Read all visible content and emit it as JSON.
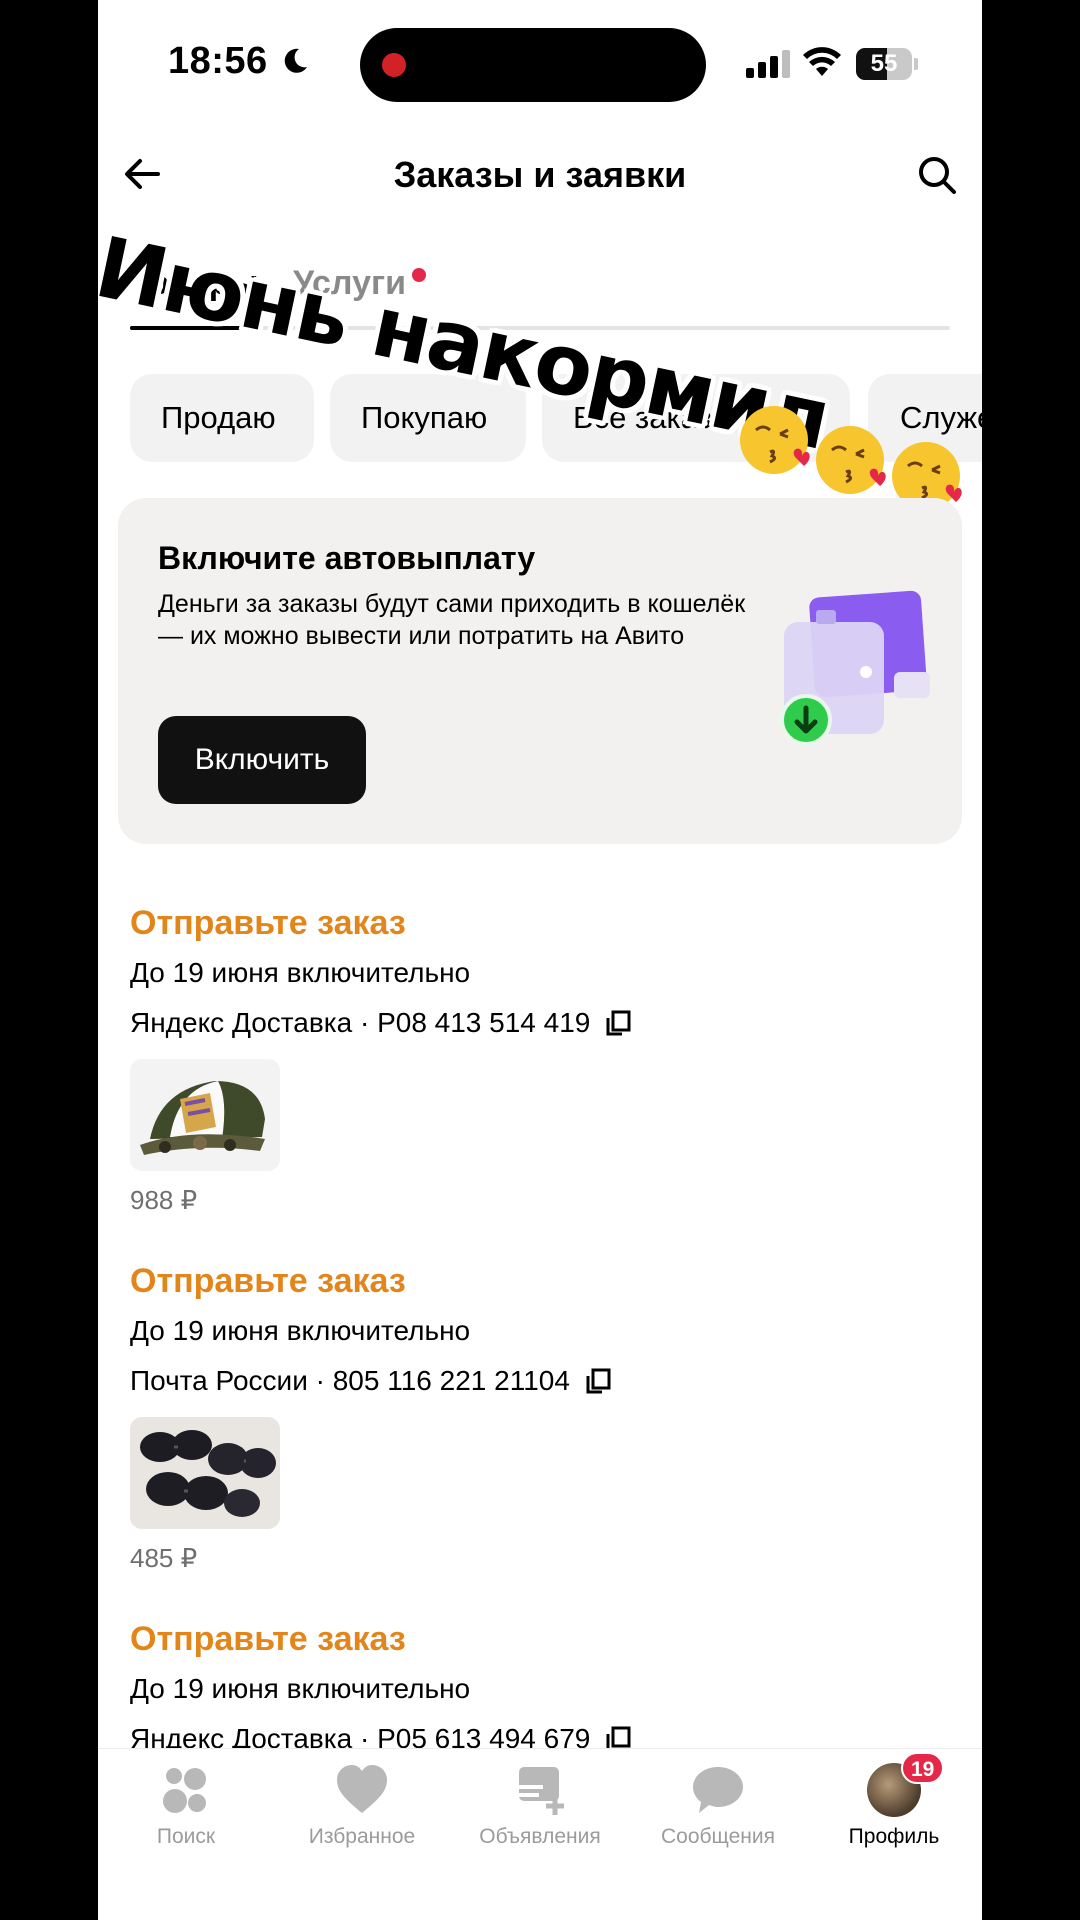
{
  "status_bar": {
    "time": "18:56",
    "battery": "55",
    "battery_level": 0.55
  },
  "header": {
    "title": "Заказы и заявки"
  },
  "tabs": [
    {
      "label": "Товары",
      "active": true
    },
    {
      "label": "Услуги",
      "active": false,
      "has_dot": true
    }
  ],
  "filters": [
    {
      "label": "Продаю"
    },
    {
      "label": "Покупаю"
    },
    {
      "label": "Все заказы",
      "dropdown": true
    },
    {
      "label": "Служебные"
    }
  ],
  "overlay": {
    "text": "Июнь накормил",
    "emoji": "kissing-face-with-heart"
  },
  "promo": {
    "title": "Включите автовыплату",
    "text": "Деньги за заказы будут сами приходить в кошелёк — их можно вывести или потратить на Авито",
    "button": "Включить"
  },
  "orders": [
    {
      "status": "Отправьте заказ",
      "deadline": "До 19 июня включительно",
      "tracking": "Яндекс Доставка · P08 413 514 419",
      "image": "camo-trucker-cap",
      "price": "988 ₽"
    },
    {
      "status": "Отправьте заказ",
      "deadline": "До 19 июня включительно",
      "tracking": "Почта России · 805 116 221 21104",
      "image": "sunglasses",
      "price": "485 ₽"
    },
    {
      "status": "Отправьте заказ",
      "deadline": "До 19 июня включительно",
      "tracking": "Яндекс Доставка · P05 613 494 679"
    }
  ],
  "nav": [
    {
      "label": "Поиск",
      "icon": "search-dots-icon"
    },
    {
      "label": "Избранное",
      "icon": "heart-icon"
    },
    {
      "label": "Объявления",
      "icon": "ads-icon"
    },
    {
      "label": "Сообщения",
      "icon": "chat-icon"
    },
    {
      "label": "Профиль",
      "icon": "avatar",
      "active": true,
      "badge": "19"
    }
  ],
  "colors": {
    "accent_orange": "#e2861b",
    "badge_red": "#e5284a",
    "chip_bg": "#f2f2f2",
    "card_bg": "#f2f1f0"
  }
}
